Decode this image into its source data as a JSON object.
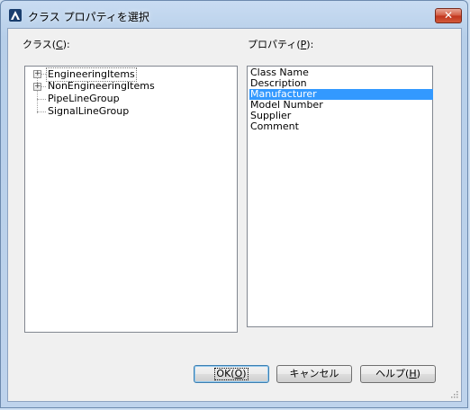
{
  "window": {
    "title": "クラス プロパティを選択",
    "close_glyph": "✕",
    "icon": "autocad-logo-icon"
  },
  "class_section": {
    "label_prefix": "クラス(",
    "label_accel": "C",
    "label_suffix": "):",
    "tree": [
      {
        "label": "EngineeringItems",
        "expandable": true,
        "expander_glyph": "+"
      },
      {
        "label": "NonEngineeringItems",
        "expandable": true,
        "expander_glyph": "+"
      },
      {
        "label": "PipeLineGroup",
        "expandable": false
      },
      {
        "label": "SignalLineGroup",
        "expandable": false
      }
    ]
  },
  "property_section": {
    "label_prefix": "プロパティ(",
    "label_accel": "P",
    "label_suffix": "):",
    "items": [
      "Class Name",
      "Description",
      "Manufacturer",
      "Model Number",
      "Supplier",
      "Comment"
    ],
    "selected": "Manufacturer"
  },
  "buttons": {
    "ok": {
      "prefix": "OK(",
      "accel": "O",
      "suffix": ")"
    },
    "cancel": {
      "label": "キャンセル"
    },
    "help": {
      "prefix": "ヘルプ(",
      "accel": "H",
      "suffix": ")"
    }
  },
  "colors": {
    "selection": "#3399ff",
    "close_button": "#c0331c",
    "title_gradient": "#c9dcf2"
  }
}
